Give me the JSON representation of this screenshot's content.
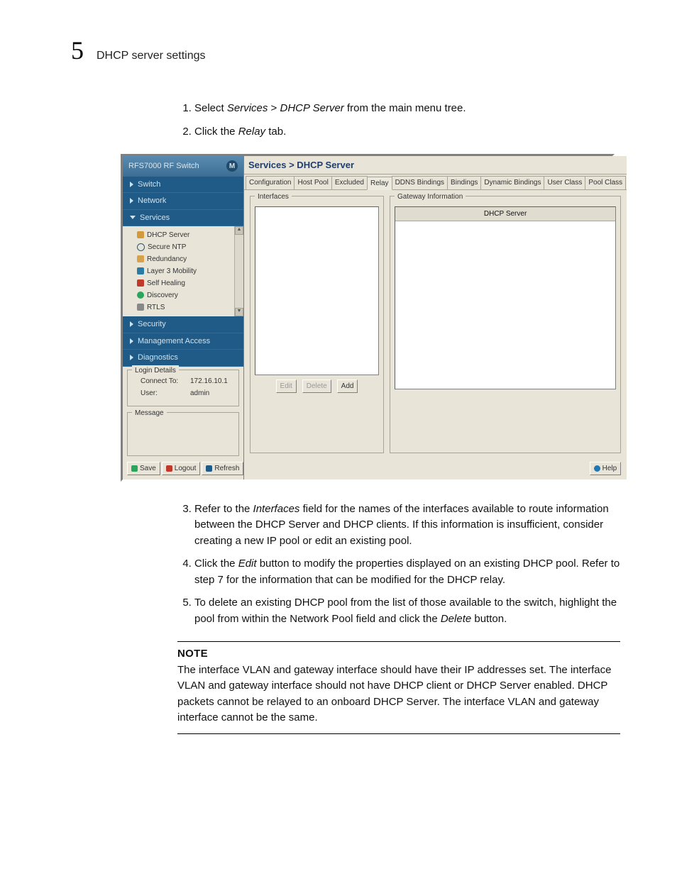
{
  "header": {
    "chapter": "5",
    "title": "DHCP server settings"
  },
  "steps_top": [
    {
      "pre": "Select ",
      "em1": "Services",
      "mid": " > ",
      "em2": "DHCP Server",
      "post": " from the main menu tree."
    },
    {
      "pre": "Click the ",
      "em1": "Relay",
      "mid": "",
      "em2": "",
      "post": " tab."
    }
  ],
  "screenshot": {
    "brand": "RFS7000 RF Switch",
    "nav": {
      "switch": "Switch",
      "network": "Network",
      "services": "Services",
      "security": "Security",
      "mgmt": "Management Access",
      "diag": "Diagnostics"
    },
    "tree": {
      "dhcp": "DHCP Server",
      "ntp": "Secure NTP",
      "red": "Redundancy",
      "l3": "Layer 3 Mobility",
      "heal": "Self Healing",
      "disc": "Discovery",
      "rtls": "RTLS"
    },
    "login": {
      "legend": "Login Details",
      "connect_lbl": "Connect To:",
      "connect_val": "172.16.10.1",
      "user_lbl": "User:",
      "user_val": "admin"
    },
    "message_legend": "Message",
    "footer": {
      "save": "Save",
      "logout": "Logout",
      "refresh": "Refresh"
    },
    "crumb": "Services > DHCP Server",
    "tabs": {
      "configuration": "Configuration",
      "hostpool": "Host Pool",
      "excluded": "Excluded",
      "relay": "Relay",
      "ddns": "DDNS Bindings",
      "bindings": "Bindings",
      "dyn": "Dynamic Bindings",
      "uclass": "User Class",
      "pclass": "Pool Class"
    },
    "interfaces_legend": "Interfaces",
    "gateway_legend": "Gateway Information",
    "gw_col": "DHCP Server",
    "buttons": {
      "edit": "Edit",
      "delete": "Delete",
      "add": "Add",
      "help": "Help"
    }
  },
  "steps_bottom": [
    {
      "pre": "Refer to the ",
      "em1": "Interfaces",
      "post": " field for the names of the interfaces available to route information between the DHCP Server and DHCP clients. If this information is insufficient, consider creating a new IP pool or edit an existing pool."
    },
    {
      "pre": "Click the ",
      "em1": "Edit",
      "post": " button to modify the properties displayed on an existing DHCP pool. Refer to step 7 for the information that can be modified for the DHCP relay."
    },
    {
      "pre": "To delete an existing DHCP pool from the list of those available to the switch, highlight the pool from within the Network Pool field and click the ",
      "em1": "Delete",
      "post": " button."
    }
  ],
  "note": {
    "title": "NOTE",
    "body": "The interface VLAN and gateway interface should have their IP addresses set. The interface VLAN and gateway interface should not have DHCP client or DHCP Server enabled. DHCP packets cannot be relayed to an onboard DHCP Server. The interface VLAN and gateway interface cannot be the same."
  }
}
